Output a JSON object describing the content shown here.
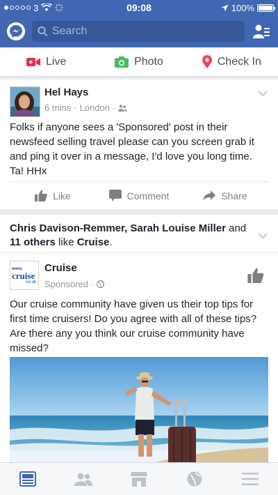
{
  "status_bar": {
    "carrier": "3",
    "time": "09:08",
    "battery": "100%"
  },
  "header": {
    "search_placeholder": "Search"
  },
  "composer": {
    "live": "Live",
    "photo": "Photo",
    "checkin": "Check In"
  },
  "post1": {
    "author": "Hel Hays",
    "time": "6 mins",
    "location": "London",
    "text": "Folks if anyone sees a 'Sponsored' post in their newsfeed selling travel please can you screen grab it and ping it over in a message, I'd love you long time. Ta! HHx",
    "actions": {
      "like": "Like",
      "comment": "Comment",
      "share": "Share"
    }
  },
  "post2": {
    "like_context_names": "Chris Davison-Remmer, Sarah Louise Miller",
    "like_context_and": " and ",
    "like_context_others": "11 others",
    "like_context_like": " like ",
    "like_context_page": "Cruise",
    "like_context_end": ".",
    "page_name": "Cruise",
    "sponsored": "Sponsored",
    "logo": {
      "www": "www.",
      "brand": "cruise",
      "tld": ".co.uk"
    },
    "text": "Our cruise community have given us their top tips for first time cruisers! Do you agree with all of these tips? Are there any you think our cruise community have missed?"
  },
  "colors": {
    "brand_blue": "#4267b2",
    "live_red": "#f02849",
    "photo_green": "#45bd62",
    "checkin_pink": "#f3425f",
    "active_tab": "#4267b2"
  },
  "icons": [
    "messenger-icon",
    "search-icon",
    "friend-requests-icon",
    "video-icon",
    "camera-icon",
    "location-pin-icon",
    "chevron-down-icon",
    "thumbs-up-icon",
    "comment-icon",
    "share-icon",
    "globe-icon",
    "friends-icon",
    "newsfeed-icon",
    "marketplace-icon",
    "menu-icon"
  ]
}
